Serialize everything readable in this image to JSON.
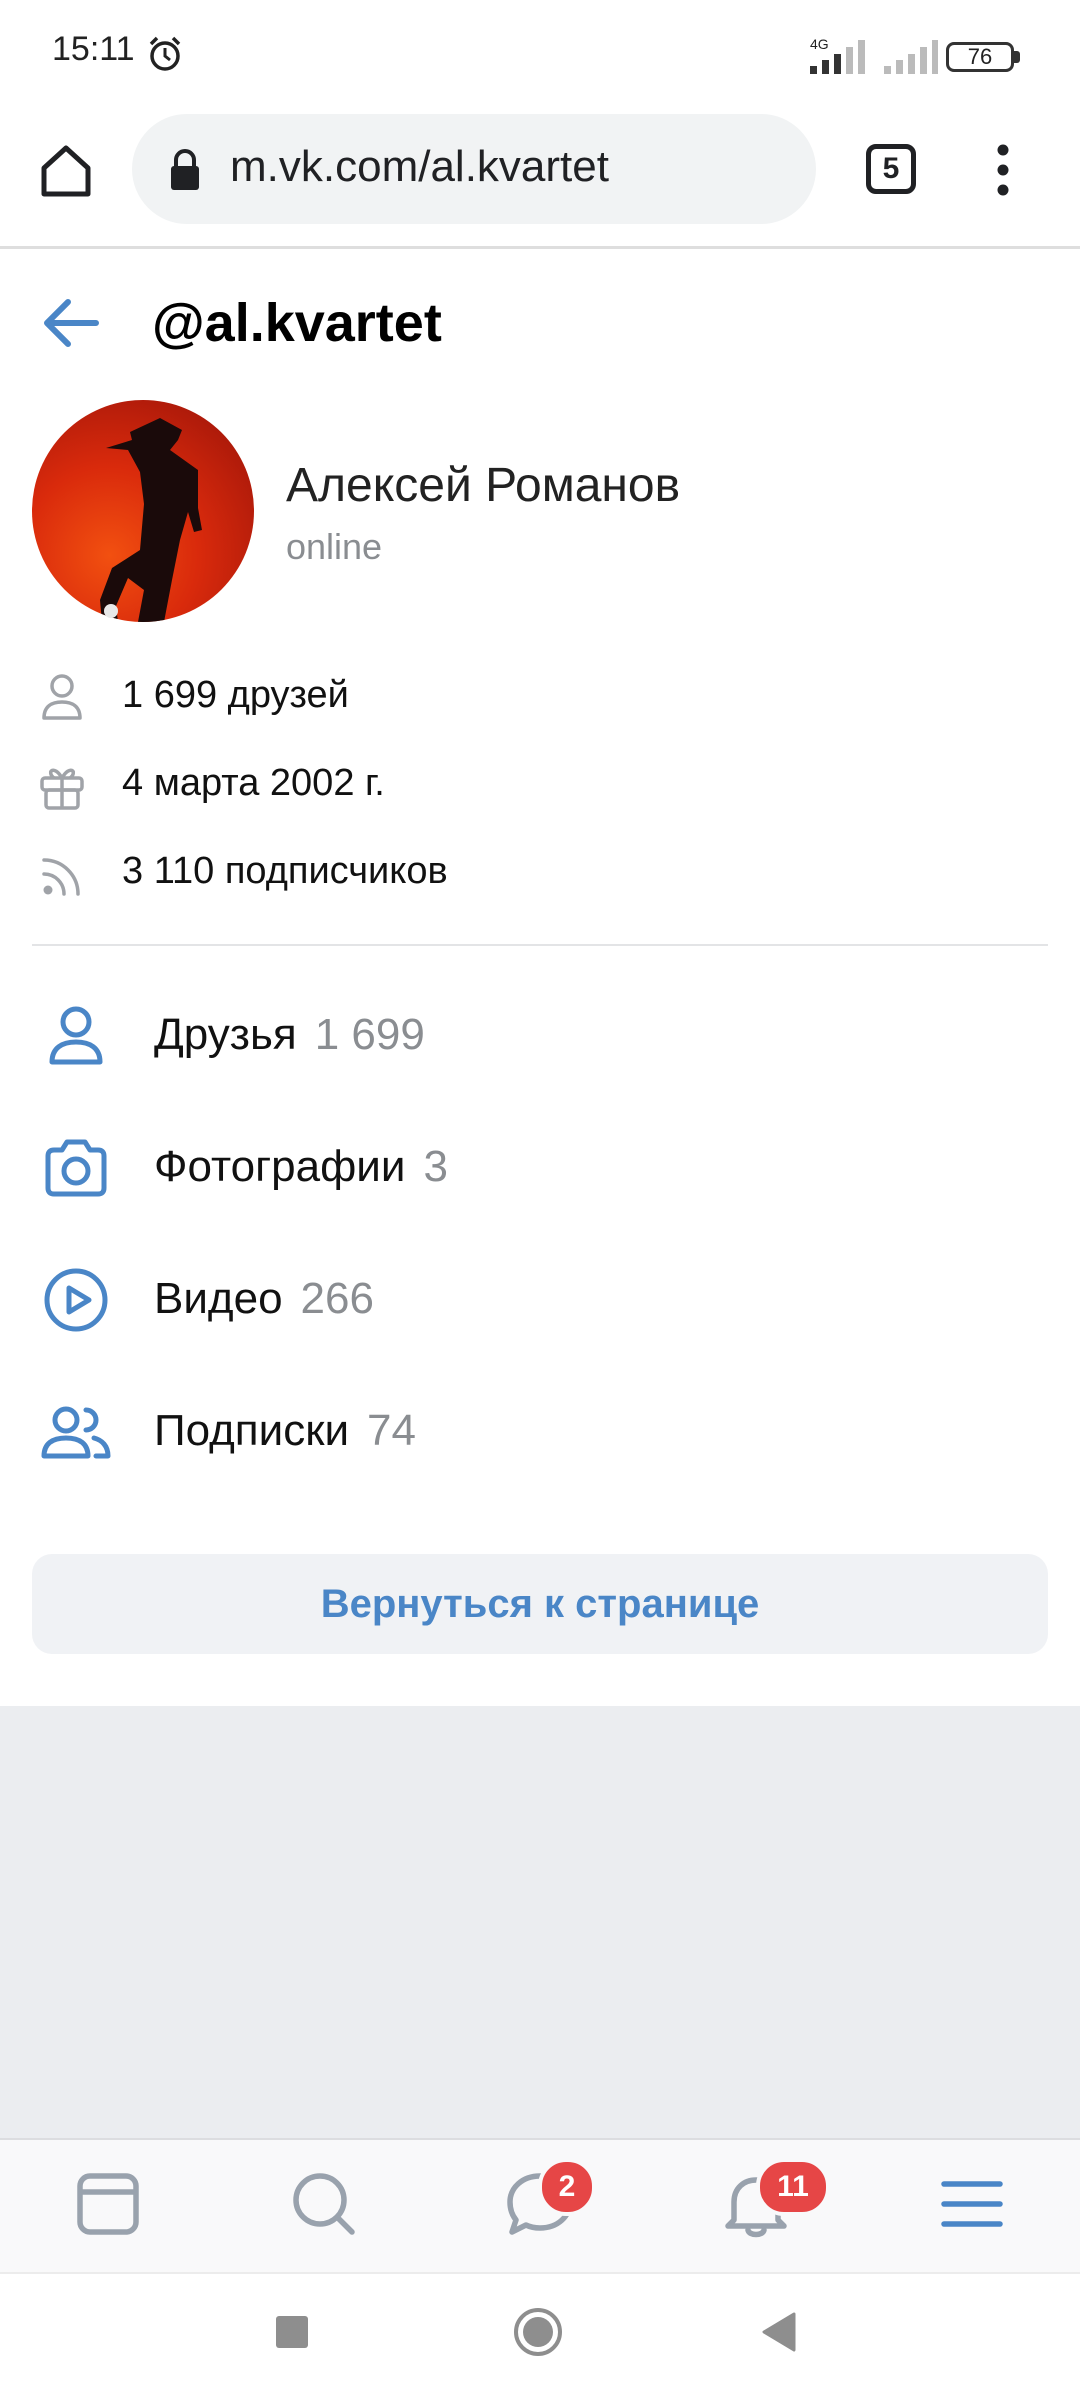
{
  "status_bar": {
    "time": "15:11",
    "network": "4G",
    "battery": "76"
  },
  "browser": {
    "url": "m.vk.com/al.kvartet",
    "tabs_count": "5"
  },
  "header": {
    "title": "@al.kvartet"
  },
  "profile": {
    "name": "Алексей Романов",
    "status": "online"
  },
  "info": {
    "friends": "1 699 друзей",
    "birthday": "4 марта 2002 г.",
    "followers": "3 110 подписчиков"
  },
  "menu": [
    {
      "label": "Друзья",
      "count": "1 699",
      "icon": "person-icon"
    },
    {
      "label": "Фотографии",
      "count": "3",
      "icon": "camera-icon"
    },
    {
      "label": "Видео",
      "count": "266",
      "icon": "play-circle-icon"
    },
    {
      "label": "Подписки",
      "count": "74",
      "icon": "people-icon"
    }
  ],
  "back_button": "Вернуться к странице",
  "tabbar": {
    "messages_badge": "2",
    "notifications_badge": "11"
  },
  "colors": {
    "accent": "#4a86c7",
    "badge": "#e64646",
    "muted": "#8a8d91"
  }
}
